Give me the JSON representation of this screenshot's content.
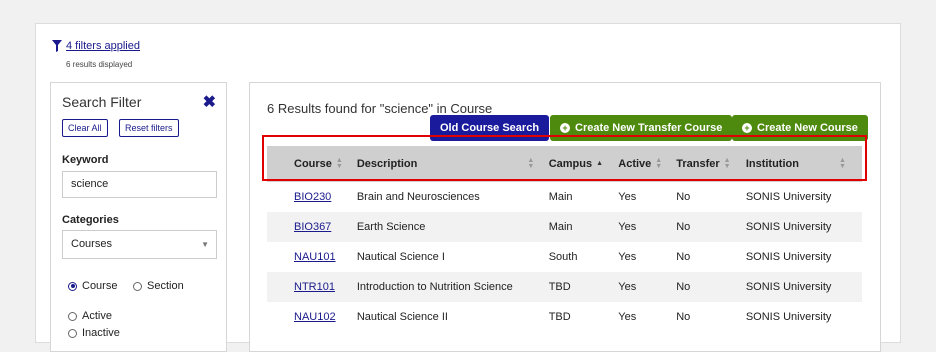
{
  "filter_summary": {
    "filters_applied": "4 filters applied",
    "results_displayed": "6 results displayed"
  },
  "sidebar": {
    "title": "Search Filter",
    "clear_all": "Clear All",
    "reset_filters": "Reset filters",
    "keyword_label": "Keyword",
    "keyword_value": "science",
    "categories_label": "Categories",
    "categories_value": "Courses",
    "radio_course": "Course",
    "radio_section": "Section",
    "radio_active": "Active",
    "radio_inactive": "Inactive"
  },
  "main": {
    "heading": "6 Results found for \"science\" in Course",
    "old_search": "Old Course Search",
    "create_transfer": "Create New Transfer Course",
    "create_course": "Create New Course",
    "columns": [
      "Course",
      "Description",
      "Campus",
      "Active",
      "Transfer",
      "Institution"
    ],
    "rows": [
      [
        "BIO230",
        "Brain and Neurosciences",
        "Main",
        "Yes",
        "No",
        "SONIS University"
      ],
      [
        "BIO367",
        "Earth Science",
        "Main",
        "Yes",
        "No",
        "SONIS University"
      ],
      [
        "NAU101",
        "Nautical Science I",
        "South",
        "Yes",
        "No",
        "SONIS University"
      ],
      [
        "NTR101",
        "Introduction to Nutrition Science",
        "TBD",
        "Yes",
        "No",
        "SONIS University"
      ],
      [
        "NAU102",
        "Nautical Science II",
        "TBD",
        "Yes",
        "No",
        "SONIS University"
      ]
    ]
  },
  "colors": {
    "primary_blue": "#1a1a9c",
    "green": "#4e8a0e",
    "highlight_red": "#e00000",
    "header_gray": "#cfcfcf"
  }
}
